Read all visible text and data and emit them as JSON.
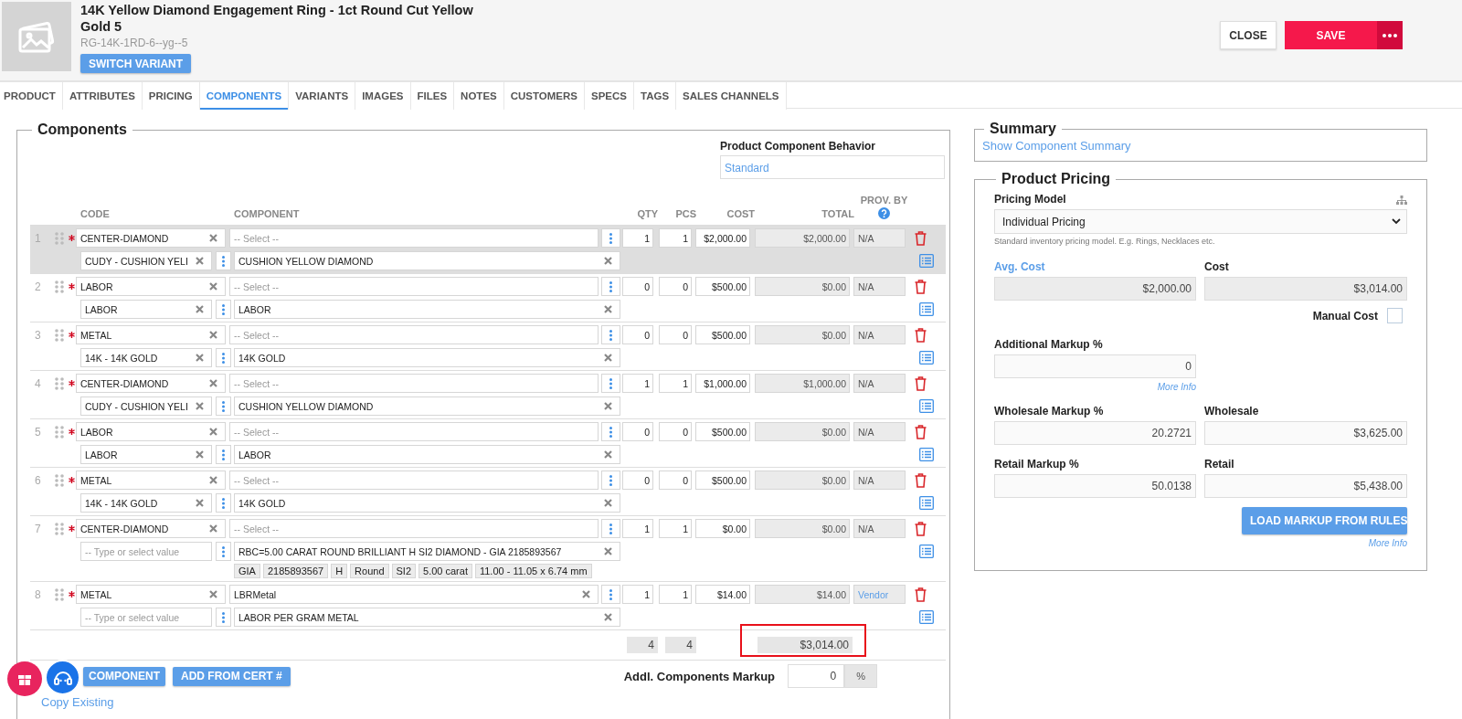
{
  "product": {
    "title": "14K Yellow Diamond Engagement Ring - 1ct Round Cut Yellow Gold 5",
    "sku": "RG-14K-1RD-6--yg--5",
    "switch_button": "SWITCH VARIANT"
  },
  "actions": {
    "close": "CLOSE",
    "save": "SAVE"
  },
  "tabs": [
    {
      "label": "PRODUCT",
      "selected": false
    },
    {
      "label": "ATTRIBUTES",
      "selected": false
    },
    {
      "label": "PRICING",
      "selected": false
    },
    {
      "label": "COMPONENTS",
      "selected": true
    },
    {
      "label": "VARIANTS",
      "selected": false
    },
    {
      "label": "IMAGES",
      "selected": false
    },
    {
      "label": "FILES",
      "selected": false
    },
    {
      "label": "NOTES",
      "selected": false
    },
    {
      "label": "CUSTOMERS",
      "selected": false
    },
    {
      "label": "SPECS",
      "selected": false
    },
    {
      "label": "TAGS",
      "selected": false
    },
    {
      "label": "SALES CHANNELS",
      "selected": false
    }
  ],
  "components": {
    "title": "Components",
    "behavior_label": "Product Component Behavior",
    "behavior_value": "Standard",
    "columns": {
      "code": "CODE",
      "component": "COMPONENT",
      "qty": "QTY",
      "pcs": "PCS",
      "cost": "COST",
      "total": "TOTAL",
      "provider": "PROV. BY"
    },
    "rows": [
      {
        "number": "1",
        "selected": true,
        "required": true,
        "code": {
          "value": "CENTER-DIAMOND"
        },
        "code_detail": {
          "value": "CUDY - CUSHION YELI"
        },
        "component": {
          "placeholder": "-- Select --"
        },
        "component_detail": {
          "value": "CUSHION YELLOW DIAMOND"
        },
        "qty": "1",
        "pcs": "1",
        "cost": "$2,000.00",
        "total": "$2,000.00",
        "provider": {
          "label": "N/A",
          "kind": "text"
        }
      },
      {
        "number": "2",
        "selected": false,
        "required": true,
        "code": {
          "value": "LABOR"
        },
        "code_detail": {
          "value": "LABOR"
        },
        "component": {
          "placeholder": "-- Select --"
        },
        "component_detail": {
          "value": "LABOR"
        },
        "qty": "0",
        "pcs": "0",
        "cost": "$500.00",
        "total": "$0.00",
        "provider": {
          "label": "N/A",
          "kind": "text"
        }
      },
      {
        "number": "3",
        "selected": false,
        "required": true,
        "code": {
          "value": "METAL"
        },
        "code_detail": {
          "value": "14K - 14K GOLD"
        },
        "component": {
          "placeholder": "-- Select --"
        },
        "component_detail": {
          "value": "14K GOLD"
        },
        "qty": "0",
        "pcs": "0",
        "cost": "$500.00",
        "total": "$0.00",
        "provider": {
          "label": "N/A",
          "kind": "text"
        }
      },
      {
        "number": "4",
        "selected": false,
        "required": true,
        "code": {
          "value": "CENTER-DIAMOND"
        },
        "code_detail": {
          "value": "CUDY - CUSHION YELI"
        },
        "component": {
          "placeholder": "-- Select --"
        },
        "component_detail": {
          "value": "CUSHION YELLOW DIAMOND"
        },
        "qty": "1",
        "pcs": "1",
        "cost": "$1,000.00",
        "total": "$1,000.00",
        "provider": {
          "label": "N/A",
          "kind": "text"
        }
      },
      {
        "number": "5",
        "selected": false,
        "required": true,
        "code": {
          "value": "LABOR"
        },
        "code_detail": {
          "value": "LABOR"
        },
        "component": {
          "placeholder": "-- Select --"
        },
        "component_detail": {
          "value": "LABOR"
        },
        "qty": "0",
        "pcs": "0",
        "cost": "$500.00",
        "total": "$0.00",
        "provider": {
          "label": "N/A",
          "kind": "text"
        }
      },
      {
        "number": "6",
        "selected": false,
        "required": true,
        "code": {
          "value": "METAL"
        },
        "code_detail": {
          "value": "14K - 14K GOLD"
        },
        "component": {
          "placeholder": "-- Select --"
        },
        "component_detail": {
          "value": "14K GOLD"
        },
        "qty": "0",
        "pcs": "0",
        "cost": "$500.00",
        "total": "$0.00",
        "provider": {
          "label": "N/A",
          "kind": "text"
        }
      },
      {
        "number": "7",
        "selected": false,
        "required": true,
        "code": {
          "value": "CENTER-DIAMOND"
        },
        "code_detail": {
          "placeholder": "-- Type or select value"
        },
        "component": {
          "placeholder": "-- Select --"
        },
        "component_detail": {
          "value": "RBC=5.00 CARAT ROUND BRILLIANT H SI2 DIAMOND - GIA 2185893567"
        },
        "qty": "1",
        "pcs": "1",
        "cost": "$0.00",
        "total": "$0.00",
        "provider": {
          "label": "N/A",
          "kind": "text"
        },
        "tags": [
          "GIA",
          "2185893567",
          "H",
          "Round",
          "SI2",
          "5.00 carat",
          "11.00 - 11.05 x 6.74 mm"
        ]
      },
      {
        "number": "8",
        "selected": false,
        "required": true,
        "code": {
          "value": "METAL"
        },
        "code_detail": {
          "placeholder": "-- Type or select value"
        },
        "component": {
          "value": "LBRMetal"
        },
        "component_detail": {
          "value": "LABOR PER GRAM METAL"
        },
        "qty": "1",
        "pcs": "1",
        "cost": "$14.00",
        "total": "$14.00",
        "provider": {
          "label": "Vendor",
          "kind": "link"
        }
      }
    ],
    "totals": {
      "qty": "4",
      "pcs": "4",
      "total": "$3,014.00",
      "highlighted": true
    },
    "add_button": "COMPONENT",
    "cert_button": "ADD FROM CERT #",
    "markup_label": "Addl. Components Markup",
    "markup_value": "0",
    "markup_unit": "%",
    "copy_link": "Copy Existing"
  },
  "summary": {
    "title": "Summary",
    "link": "Show Component Summary"
  },
  "pricing": {
    "title": "Product Pricing",
    "model_label": "Pricing Model",
    "model_value": "Individual Pricing",
    "model_hint": "Standard inventory pricing model. E.g. Rings, Necklaces etc.",
    "avg_cost": {
      "label": "Avg. Cost",
      "value": "$2,000.00",
      "disabled": true,
      "link": true
    },
    "cost": {
      "label": "Cost",
      "value": "$3,014.00",
      "disabled": true,
      "link": false
    },
    "manual_cost": {
      "label": "Manual Cost",
      "checked": false
    },
    "additional_markup": {
      "label": "Additional Markup %",
      "value": "0",
      "disabled": false,
      "link": false
    },
    "more_info": "More Info",
    "wholesale_markup": {
      "label": "Wholesale Markup %",
      "value": "20.2721",
      "disabled": false,
      "link": false
    },
    "wholesale": {
      "label": "Wholesale",
      "value": "$3,625.00",
      "disabled": false,
      "link": false
    },
    "retail_markup": {
      "label": "Retail Markup %",
      "value": "50.0138",
      "disabled": false,
      "link": false
    },
    "retail": {
      "label": "Retail",
      "value": "$5,438.00",
      "disabled": false,
      "link": false
    },
    "load_button": "LOAD MARKUP FROM RULES",
    "more_info_bottom": "More Info"
  }
}
